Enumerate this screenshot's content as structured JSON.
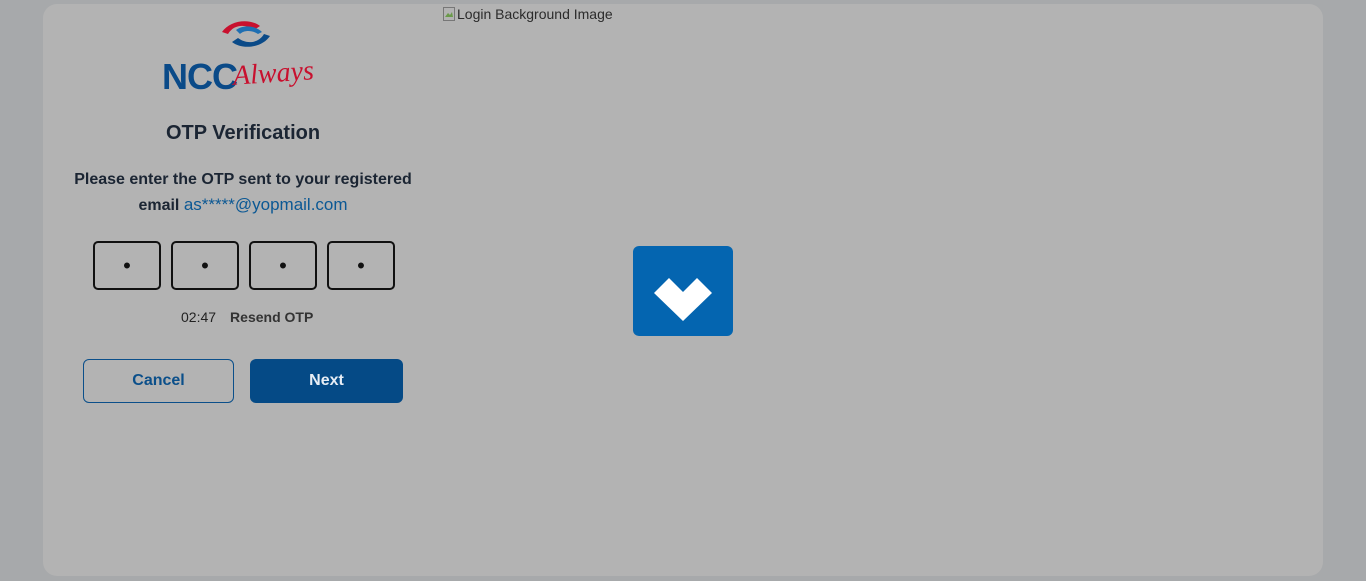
{
  "background_image": {
    "alt": "Login Background Image"
  },
  "logo": {
    "brand": "NCC",
    "script": "Always"
  },
  "otp": {
    "title": "OTP Verification",
    "message_line1": "Please enter the OTP sent to your registered",
    "message_prefix": "email",
    "email": "as*****@yopmail.com",
    "digits": [
      "•",
      "•",
      "•",
      "•"
    ],
    "timer": "02:47",
    "resend_label": "Resend OTP"
  },
  "actions": {
    "cancel_label": "Cancel",
    "next_label": "Next"
  },
  "colors": {
    "primary": "#054a86",
    "loader": "#0465b0",
    "accent_red": "#c8102e"
  },
  "loader": {
    "icon": "heart-check-icon"
  }
}
